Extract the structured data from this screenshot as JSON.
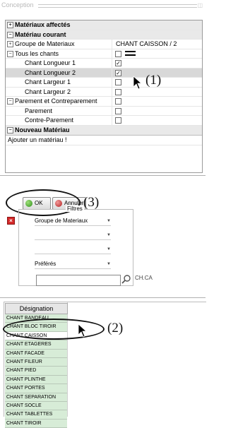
{
  "panel": {
    "title": "Conception",
    "rows": [
      {
        "kind": "cat",
        "expander": "⊞",
        "label": "Matériaux affectés"
      },
      {
        "kind": "cat",
        "expander": "⊟",
        "label": "Matériau courant"
      },
      {
        "kind": "row",
        "expander": "⊞",
        "label": "Groupe de Materiaux",
        "value": "CHANT CAISSON / 2"
      },
      {
        "kind": "row",
        "expander": "⊟",
        "label": "Tous les chants",
        "checked": false,
        "glyph": true
      },
      {
        "kind": "sub",
        "label": "Chant Longueur 1",
        "checked": true
      },
      {
        "kind": "sub-sel",
        "label": "Chant Longueur 2",
        "checked": true
      },
      {
        "kind": "sub",
        "label": "Chant Largeur 1",
        "checked": false
      },
      {
        "kind": "sub",
        "label": "Chant Largeur 2",
        "checked": false
      },
      {
        "kind": "row",
        "expander": "⊟",
        "label": "Parement et Contreparement",
        "checked": false
      },
      {
        "kind": "sub",
        "label": "Parement",
        "checked": false
      },
      {
        "kind": "sub",
        "label": "Contre-Parement",
        "checked": false
      },
      {
        "kind": "cat",
        "expander": "⊟",
        "label": "Nouveau Matériau"
      },
      {
        "kind": "add",
        "label": "Ajouter un matériau !"
      }
    ]
  },
  "annotations": {
    "a1": "(1)",
    "a2": "(2)",
    "a3": "(3)"
  },
  "buttons": {
    "ok_label": "OK",
    "cancel_label": "Annuler"
  },
  "filters": {
    "legend": "Filtres",
    "group_label": "Groupe de Materiaux",
    "favorites_label": "Préférés",
    "search_value": "",
    "search_code": "CH.CA"
  },
  "list": {
    "header": "Désignation",
    "items": [
      "CHANT BANDEAU",
      "CHANT BLOC TIROIR",
      "CHANT CAISSON",
      "CHANT ETAGERES",
      "CHANT FACADE",
      "CHANT FILEUR",
      "CHANT PIED",
      "CHANT PLINTHE",
      "CHANT PORTES",
      "CHANT SEPARATION",
      "CHANT SOCLE",
      "CHANT TABLETTES",
      "CHANT TIROIR"
    ],
    "selected_index": 2
  }
}
